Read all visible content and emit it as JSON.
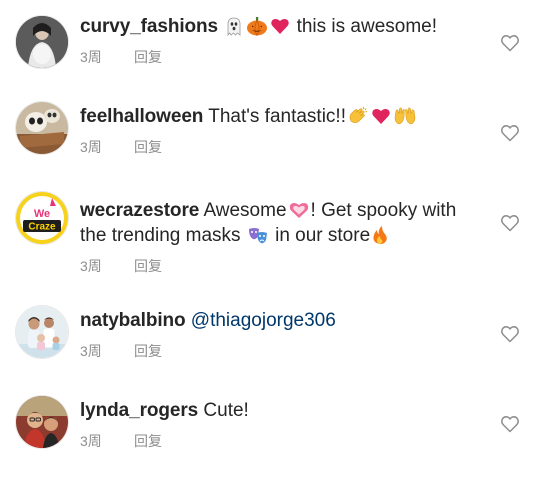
{
  "comments": [
    {
      "username": "curvy_fashions",
      "text": "this is awesome!",
      "time": "3周",
      "reply_label": "回复"
    },
    {
      "username": "feelhalloween",
      "text": "That's fantastic!!",
      "time": "3周",
      "reply_label": "回复"
    },
    {
      "username": "wecrazestore",
      "text_part1": "Awesome",
      "text_part2": "! Get spooky with",
      "text_part3": "the trending masks",
      "text_part4": "in our store",
      "time": "3周",
      "reply_label": "回复",
      "avatar_logo_text": "We Craze"
    },
    {
      "username": "natybalbino",
      "mention": "@thiagojorge306",
      "time": "3周",
      "reply_label": "回复"
    },
    {
      "username": "lynda_rogers",
      "text": "Cute!",
      "time": "3周",
      "reply_label": "回复"
    }
  ],
  "icons": {
    "like": "heart-outline-icon",
    "ghost": "ghost-emoji-icon",
    "pumpkin": "pumpkin-emoji-icon",
    "heart": "pink-heart-emoji-icon",
    "clap": "clapping-hands-emoji-icon",
    "raised_hands": "raised-hands-emoji-icon",
    "masks": "performing-arts-emoji-icon",
    "fire": "fire-emoji-icon"
  },
  "colors": {
    "text": "#262626",
    "meta": "#8e8e8e",
    "mention": "#00376b",
    "heart_emoji": "#e0245e"
  }
}
